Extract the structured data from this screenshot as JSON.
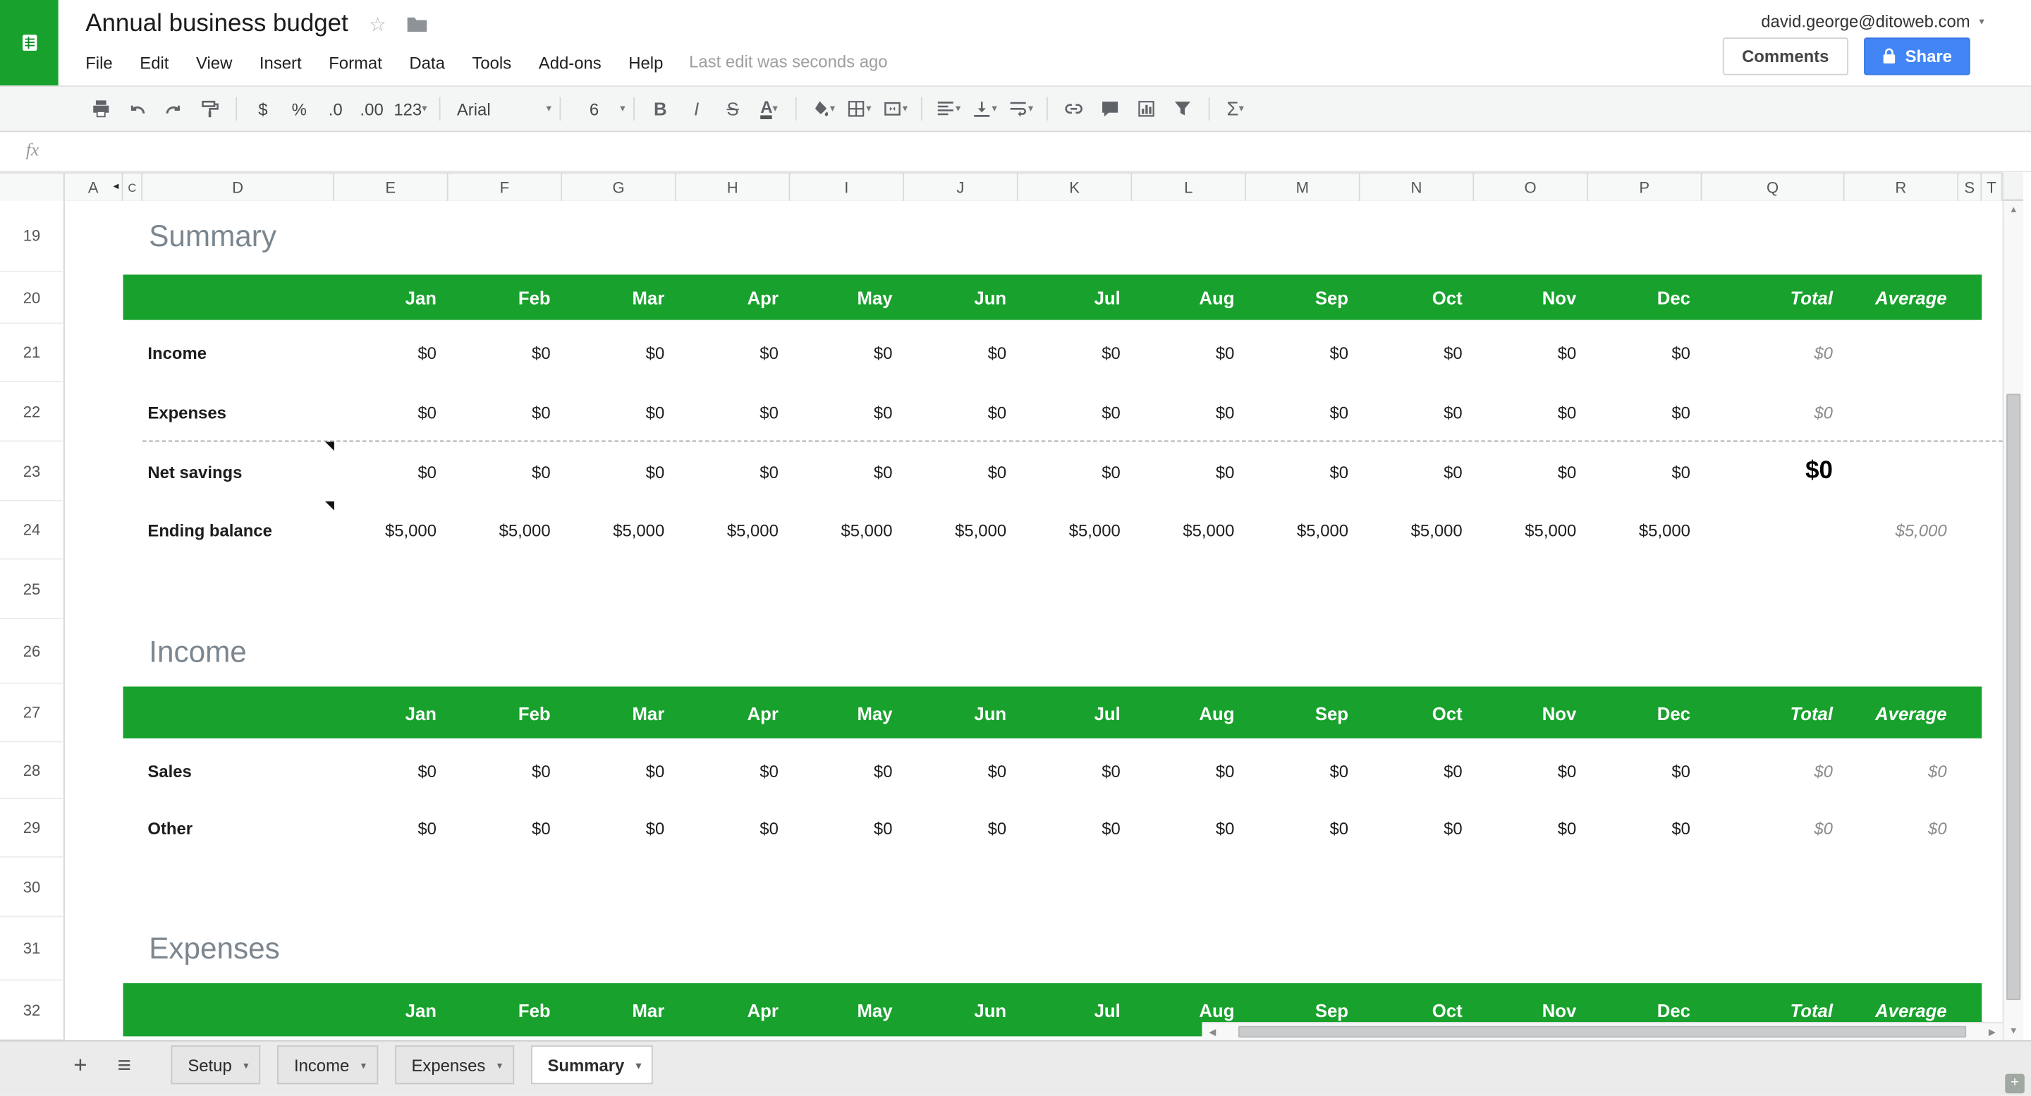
{
  "colors": {
    "accent_green": "#18a22d",
    "share_blue": "#4285f4",
    "section_title_gray": "#7b868f"
  },
  "header": {
    "title": "Annual business budget",
    "account_email": "david.george@ditoweb.com",
    "menus": [
      "File",
      "Edit",
      "View",
      "Insert",
      "Format",
      "Data",
      "Tools",
      "Add-ons",
      "Help"
    ],
    "last_edit": "Last edit was seconds ago",
    "comments_label": "Comments",
    "share_label": "Share"
  },
  "toolbar": {
    "font_name": "Arial",
    "font_size": "6",
    "currency": "$",
    "percent": "%",
    "decimal_decrease": ".0",
    "decimal_increase": ".00",
    "more_formats": "123",
    "bold": "B",
    "italic": "I",
    "strikethrough": "S",
    "text_color": "A",
    "functions": "Σ"
  },
  "formula_bar": {
    "label": "fx"
  },
  "sheet": {
    "column_letters": [
      "A",
      "C",
      "D",
      "E",
      "F",
      "G",
      "H",
      "I",
      "J",
      "K",
      "L",
      "M",
      "N",
      "O",
      "P",
      "Q",
      "R",
      "S",
      "T"
    ],
    "months": [
      "Jan",
      "Feb",
      "Mar",
      "Apr",
      "May",
      "Jun",
      "Jul",
      "Aug",
      "Sep",
      "Oct",
      "Nov",
      "Dec"
    ],
    "total_label": "Total",
    "average_label": "Average",
    "rows": [
      {
        "num": 19,
        "type": "title",
        "text": "Summary"
      },
      {
        "num": 20,
        "type": "band"
      },
      {
        "num": 21,
        "type": "data",
        "label": "Income",
        "values": [
          "$0",
          "$0",
          "$0",
          "$0",
          "$0",
          "$0",
          "$0",
          "$0",
          "$0",
          "$0",
          "$0",
          "$0"
        ],
        "total": "$0",
        "total_style": "muted"
      },
      {
        "num": 22,
        "type": "data",
        "label": "Expenses",
        "values": [
          "$0",
          "$0",
          "$0",
          "$0",
          "$0",
          "$0",
          "$0",
          "$0",
          "$0",
          "$0",
          "$0",
          "$0"
        ],
        "total": "$0",
        "total_style": "muted"
      },
      {
        "num": 23,
        "type": "data",
        "label": "Net savings",
        "note": true,
        "dashed_top": true,
        "values": [
          "$0",
          "$0",
          "$0",
          "$0",
          "$0",
          "$0",
          "$0",
          "$0",
          "$0",
          "$0",
          "$0",
          "$0"
        ],
        "total": "$0",
        "total_style": "big"
      },
      {
        "num": 24,
        "type": "data",
        "label": "Ending balance",
        "note": true,
        "values": [
          "$5,000",
          "$5,000",
          "$5,000",
          "$5,000",
          "$5,000",
          "$5,000",
          "$5,000",
          "$5,000",
          "$5,000",
          "$5,000",
          "$5,000",
          "$5,000"
        ],
        "average": "$5,000",
        "average_style": "muted"
      },
      {
        "num": 25,
        "type": "empty"
      },
      {
        "num": 26,
        "type": "title",
        "text": "Income"
      },
      {
        "num": 27,
        "type": "band"
      },
      {
        "num": 28,
        "type": "data",
        "label": "Sales",
        "values": [
          "$0",
          "$0",
          "$0",
          "$0",
          "$0",
          "$0",
          "$0",
          "$0",
          "$0",
          "$0",
          "$0",
          "$0"
        ],
        "total": "$0",
        "total_style": "muted",
        "average": "$0",
        "average_style": "muted"
      },
      {
        "num": 29,
        "type": "data",
        "label": "Other",
        "values": [
          "$0",
          "$0",
          "$0",
          "$0",
          "$0",
          "$0",
          "$0",
          "$0",
          "$0",
          "$0",
          "$0",
          "$0"
        ],
        "total": "$0",
        "total_style": "muted",
        "average": "$0",
        "average_style": "muted"
      },
      {
        "num": 30,
        "type": "empty"
      },
      {
        "num": 31,
        "type": "title",
        "text": "Expenses"
      },
      {
        "num": 32,
        "type": "band"
      }
    ]
  },
  "tabs": {
    "items": [
      {
        "label": "Setup",
        "active": false
      },
      {
        "label": "Income",
        "active": false
      },
      {
        "label": "Expenses",
        "active": false
      },
      {
        "label": "Summary",
        "active": true
      }
    ]
  }
}
